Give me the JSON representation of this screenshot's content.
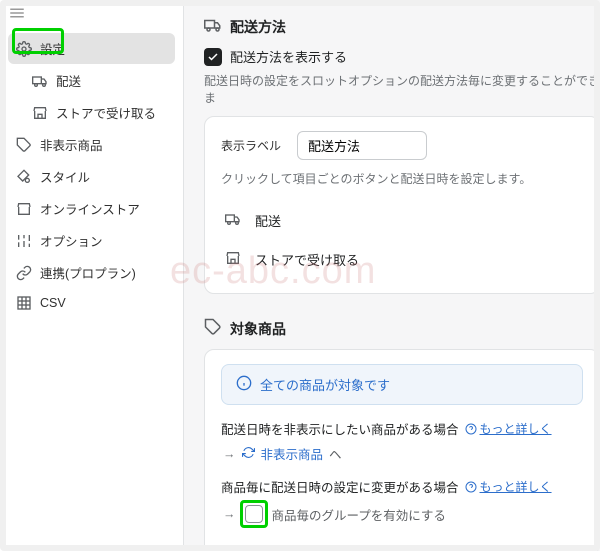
{
  "sidebar": {
    "items": [
      {
        "label": "設定"
      },
      {
        "label": "配送"
      },
      {
        "label": "ストアで受け取る"
      },
      {
        "label": "非表示商品"
      },
      {
        "label": "スタイル"
      },
      {
        "label": "オンラインストア"
      },
      {
        "label": "オプション"
      },
      {
        "label": "連携(プロプラン)"
      },
      {
        "label": "CSV"
      }
    ]
  },
  "delivery": {
    "title": "配送方法",
    "show_label": "配送方法を表示する",
    "desc": "配送日時の設定をスロットオプションの配送方法毎に変更することができま",
    "display_label_title": "表示ラベル",
    "display_label_value": "配送方法",
    "click_help": "クリックして項目ごとのボタンと配送日時を設定します。",
    "methods": [
      {
        "name": "配送"
      },
      {
        "name": "ストアで受け取る"
      }
    ]
  },
  "target": {
    "title": "対象商品",
    "info": "全ての商品が対象です",
    "block1_line1": "配送日時を非表示にしたい商品がある場合",
    "block1_link": "非表示商品",
    "block1_he": "ヘ",
    "block2_line1": "商品毎に配送日時の設定に変更がある場合",
    "block2_desc": "商品毎のグループを有効にする",
    "more_link": "もっと詳しく"
  },
  "watermark": "ec-abc.com"
}
